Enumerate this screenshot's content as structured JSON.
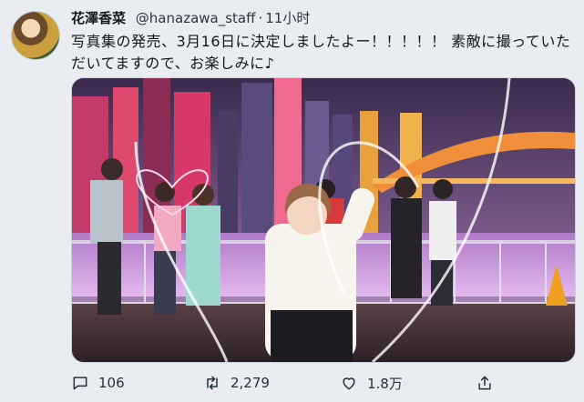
{
  "tweet": {
    "display_name": "花澤香菜",
    "handle": "@hanazawa_staff",
    "separator": "·",
    "time": "11小时",
    "text": "写真集の発売、3月16日に決定しましたよー！！！！！ 素敵に撮っていただいてますので、お楽しみに♪"
  },
  "actions": {
    "reply_count": "106",
    "retweet_count": "2,279",
    "like_count": "1.8万"
  },
  "icons": {
    "reply": "speech-bubble-icon",
    "retweet": "retweet-arrows-icon",
    "like": "heart-icon",
    "share": "share-upload-icon"
  }
}
